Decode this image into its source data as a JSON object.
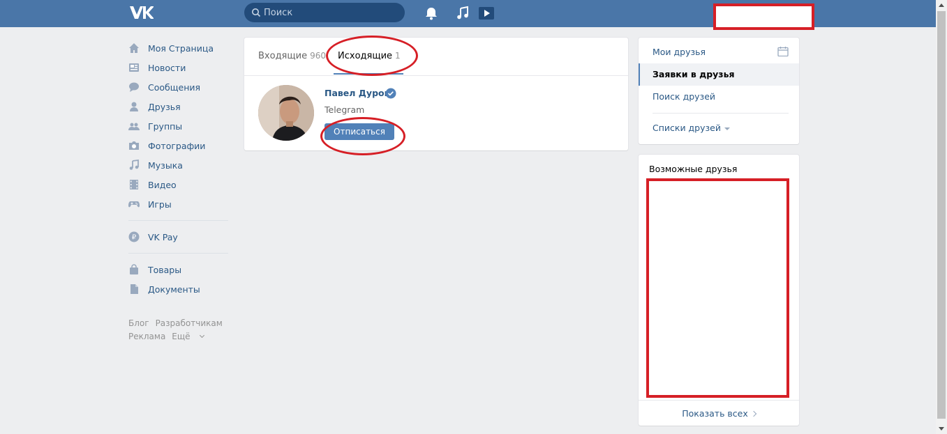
{
  "header": {
    "logo_text": "VK",
    "search_placeholder": "Поиск",
    "accent": "#4a76a8"
  },
  "leftmenu": {
    "items": [
      {
        "label": "Моя Страница",
        "icon": "home-icon"
      },
      {
        "label": "Новости",
        "icon": "news-icon"
      },
      {
        "label": "Сообщения",
        "icon": "messages-icon"
      },
      {
        "label": "Друзья",
        "icon": "friends-icon"
      },
      {
        "label": "Группы",
        "icon": "groups-icon"
      },
      {
        "label": "Фотографии",
        "icon": "camera-icon"
      },
      {
        "label": "Музыка",
        "icon": "music-icon"
      },
      {
        "label": "Видео",
        "icon": "video-icon"
      },
      {
        "label": "Игры",
        "icon": "gamepad-icon"
      }
    ],
    "vkpay": "VK Pay",
    "items2": [
      {
        "label": "Товары",
        "icon": "bag-icon"
      },
      {
        "label": "Документы",
        "icon": "document-icon"
      }
    ],
    "footer": {
      "blog": "Блог",
      "developers": "Разработчикам",
      "ads": "Реклама",
      "more": "Ещё"
    }
  },
  "main": {
    "tabs": [
      {
        "label": "Входящие",
        "count": "960"
      },
      {
        "label": "Исходящие",
        "count": "1"
      }
    ],
    "request": {
      "name": "Павел Дуров",
      "subtitle": "Telegram",
      "button": "Отписаться"
    }
  },
  "rightmenu": {
    "items": [
      "Мои друзья",
      "Заявки в друзья",
      "Поиск друзей"
    ],
    "lists": "Списки друзей"
  },
  "possible": {
    "title": "Возможные друзья",
    "show_all": "Показать всех"
  },
  "colors": {
    "highlight_red": "#d61f26",
    "link": "#2a5885",
    "button": "#5181b8"
  }
}
